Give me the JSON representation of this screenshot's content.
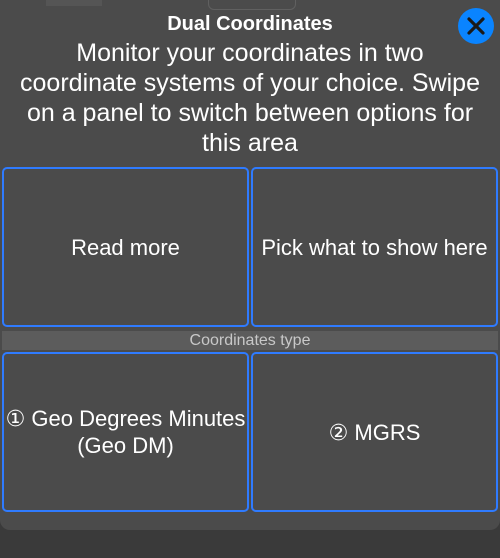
{
  "dialog": {
    "title": "Dual Coordinates",
    "description": "Monitor your coordinates in two coordinate systems of your choice. Swipe on a panel to switch between options for this area",
    "close_icon": "close-icon",
    "accent_color": "#0a84ff"
  },
  "top_panels": {
    "left_label": "Read more",
    "right_label": "Pick what to show here"
  },
  "coordinates_type": {
    "label": "Coordinates type",
    "first_option": "① Geo Degrees Minutes (Geo DM)",
    "second_option": "② MGRS"
  }
}
